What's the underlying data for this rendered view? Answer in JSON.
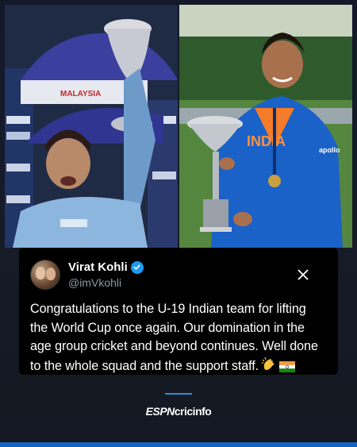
{
  "photos": {
    "left": {
      "banner_text": "MALAYSIA"
    },
    "right": {
      "jersey_text": "INDIA",
      "sponsor_text": "apollo"
    }
  },
  "tweet": {
    "display_name": "Virat Kohli",
    "handle": "@imVkohli",
    "text": "Congratulations to the U-19 Indian team for lifting the World Cup once again. Our domination in the age group cricket and beyond continues. Well done to the whole squad and the support staff.",
    "emojis": [
      "clapping-hands",
      "india-flag"
    ]
  },
  "footer": {
    "brand_espn": "ESPN",
    "brand_cric": "cricinfo"
  },
  "colors": {
    "background": "#141824",
    "card": "#000000",
    "verified": "#1d9bf0",
    "accent": "#2b8fd6",
    "bottom_bar": "#1565c0"
  }
}
